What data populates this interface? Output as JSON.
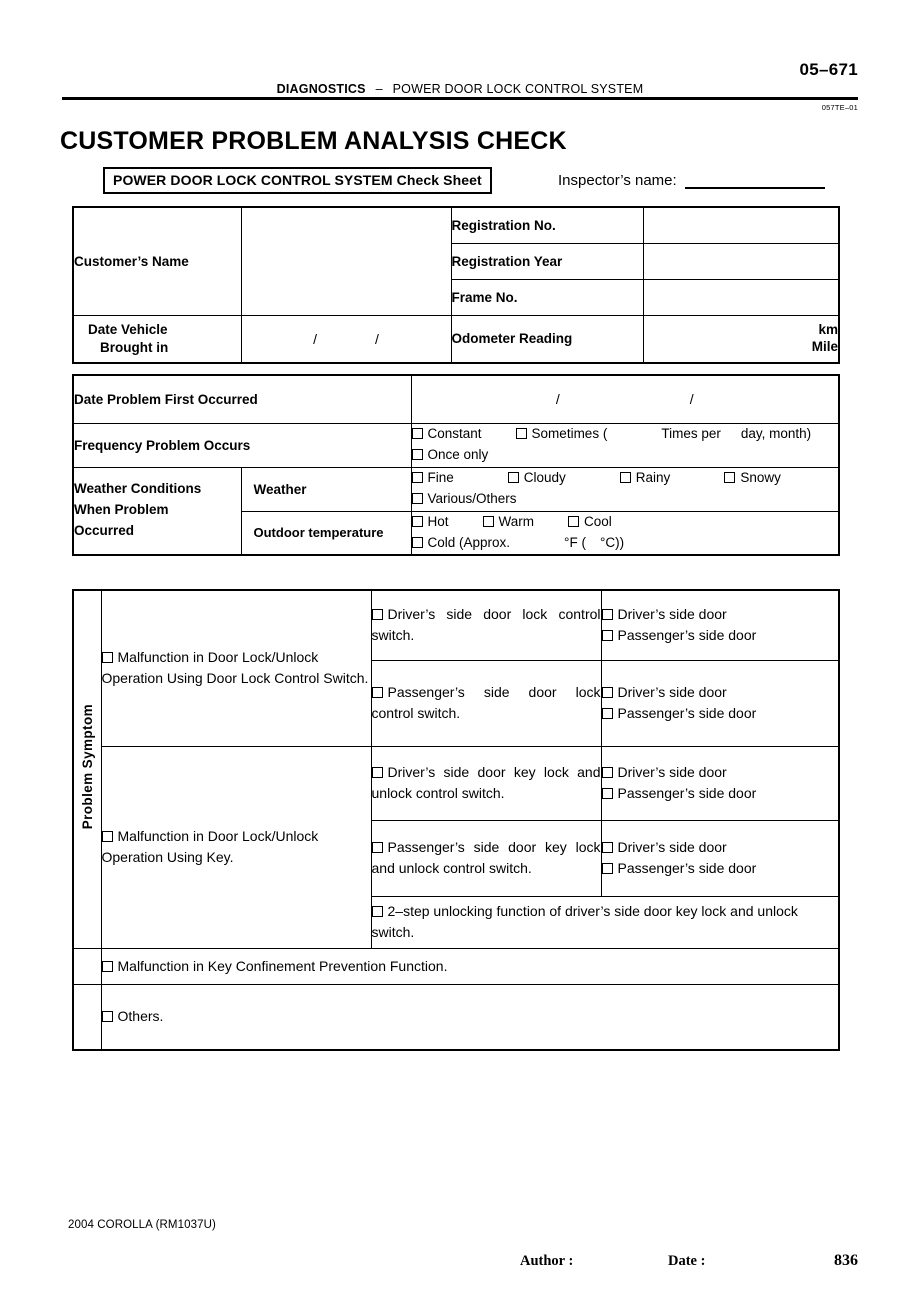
{
  "header": {
    "page_corner": "05–671",
    "running_head_bold": "DIAGNOSTICS",
    "running_head_dash": "–",
    "running_head_rest": "POWER DOOR LOCK CONTROL SYSTEM",
    "doc_ref": "057TE–01",
    "main_title": "CUSTOMER PROBLEM ANALYSIS CHECK"
  },
  "sheet": {
    "title": "POWER DOOR LOCK CONTROL SYSTEM Check Sheet",
    "inspector_label": "Inspector’s name:"
  },
  "customer_table": {
    "customers_name_label": "Customer’s Name",
    "registration_no_label": "Registration No.",
    "registration_year_label": "Registration Year",
    "frame_no_label": "Frame No.",
    "date_brought_in_label_line1": "Date Vehicle",
    "date_brought_in_label_line2": "Brought in",
    "date_brought_in_value": "/",
    "date_brought_in_value2": "/",
    "odometer_label": "Odometer Reading",
    "odometer_unit_km": "km",
    "odometer_unit_mile": "Mile",
    "customers_name_value": "",
    "registration_no_value": "",
    "registration_year_value": "",
    "frame_no_value": ""
  },
  "occurrence_table": {
    "date_first_occurred_label": "Date Problem First Occurred",
    "date_first_occurred_slash1": "/",
    "date_first_occurred_slash2": "/",
    "frequency_label": "Frequency Problem Occurs",
    "frequency_options": [
      "Constant",
      "Sometimes (",
      "Times per",
      "day, month)",
      "Once only"
    ],
    "weather_conditions_label_line1": "Weather Conditions",
    "weather_conditions_label_line2": "When Problem",
    "weather_conditions_label_line3": "Occurred",
    "weather_label": "Weather",
    "weather_options": [
      "Fine",
      "Cloudy",
      "Rainy",
      "Snowy",
      "Various/Others"
    ],
    "outdoor_temperature_label": "Outdoor temperature",
    "temperature_options": [
      "Hot",
      "Warm",
      "Cool"
    ],
    "temperature_cold": "Cold (Approx.",
    "temperature_f": "°F (",
    "temperature_c": "°C))"
  },
  "symptom_table": {
    "vertical_label": "Problem Symptom",
    "group1_title": "Malfunction in Door Lock/Unlock  Operation Using Door Lock Control Switch.",
    "group1_rows": [
      {
        "switch": "Driver’s side door lock control switch.",
        "doors": [
          "Driver’s side door",
          "Passenger’s side door"
        ]
      },
      {
        "switch": "Passenger’s side door lock control switch.",
        "doors": [
          "Driver’s side door",
          "Passenger’s side door"
        ]
      }
    ],
    "group2_title": "Malfunction in Door Lock/Unlock  Operation Using Key.",
    "group2_rows": [
      {
        "switch": "Driver’s side door key lock and unlock control switch.",
        "doors": [
          "Driver’s side door",
          "Passenger’s side door"
        ]
      },
      {
        "switch": "Passenger’s side door key lock and unlock control switch.",
        "doors": [
          "Driver’s side door",
          "Passenger’s side door"
        ]
      }
    ],
    "two_step_row": "2–step unlocking function of driver’s side door key lock and unlock switch.",
    "key_confinement_row": "Malfunction in Key Confinement Prevention Function.",
    "others_row": "Others."
  },
  "footer": {
    "model": "2004 COROLLA   (RM1037U)",
    "author_label": "Author :",
    "date_label": "Date :",
    "page_number": "836"
  }
}
